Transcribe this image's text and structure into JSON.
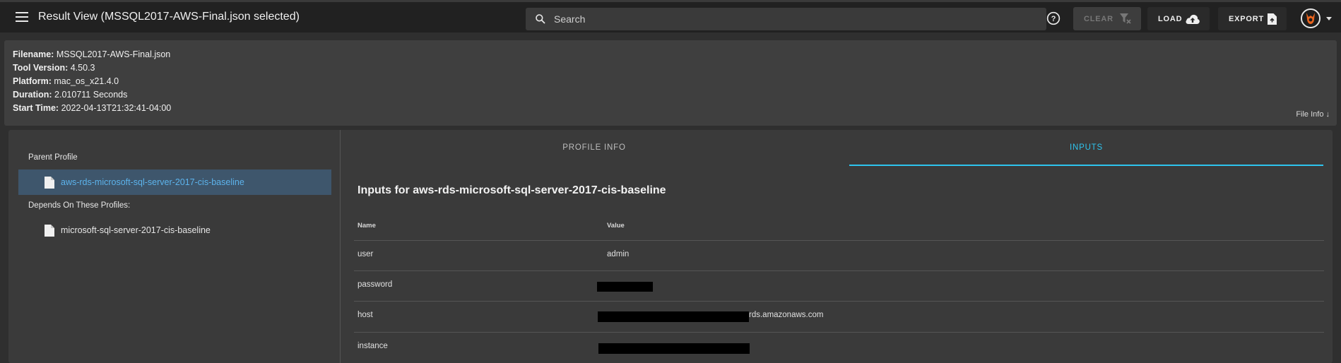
{
  "appbar": {
    "title": "Result View (MSSQL2017-AWS-Final.json selected)",
    "search_placeholder": "Search",
    "clear_label": "CLEAR",
    "load_label": "LOAD",
    "export_label": "EXPORT",
    "icons": [
      "menu-icon",
      "search-icon",
      "help-icon",
      "clear-filter-icon",
      "cloud-upload-icon",
      "file-export-icon",
      "avatar-logo"
    ]
  },
  "file_info": {
    "filename_label": "Filename:",
    "filename": "MSSQL2017-AWS-Final.json",
    "tool_version_label": "Tool Version:",
    "tool_version": "4.50.3",
    "platform_label": "Platform:",
    "platform": "mac_os_x21.4.0",
    "duration_label": "Duration:",
    "duration": "2.010711 Seconds",
    "start_time_label": "Start Time:",
    "start_time": "2022-04-13T21:32:41-04:00",
    "toggle_label": "File Info ↓"
  },
  "profiles": {
    "parent_heading": "Parent Profile",
    "parent": "aws-rds-microsoft-sql-server-2017-cis-baseline",
    "depends_heading": "Depends On These Profiles:",
    "depends": [
      "microsoft-sql-server-2017-cis-baseline"
    ]
  },
  "tabs": {
    "profile_info": "PROFILE INFO",
    "inputs": "INPUTS",
    "active": "INPUTS"
  },
  "inputs": {
    "title": "Inputs for aws-rds-microsoft-sql-server-2017-cis-baseline",
    "columns": [
      "Name",
      "Value"
    ],
    "rows": [
      {
        "name": "user",
        "value": "admin"
      },
      {
        "name": "password",
        "value": ""
      },
      {
        "name": "host",
        "value": "rds.amazonaws.com"
      },
      {
        "name": "instance",
        "value": ""
      }
    ]
  },
  "colors": {
    "appbar_bg": "#212121",
    "page_bg": "#2f2f2f",
    "card_bg": "#3a3a3a",
    "accent": "#2ec4ee",
    "selected_bg": "#3e566c",
    "selected_text": "#5cb3ec"
  }
}
